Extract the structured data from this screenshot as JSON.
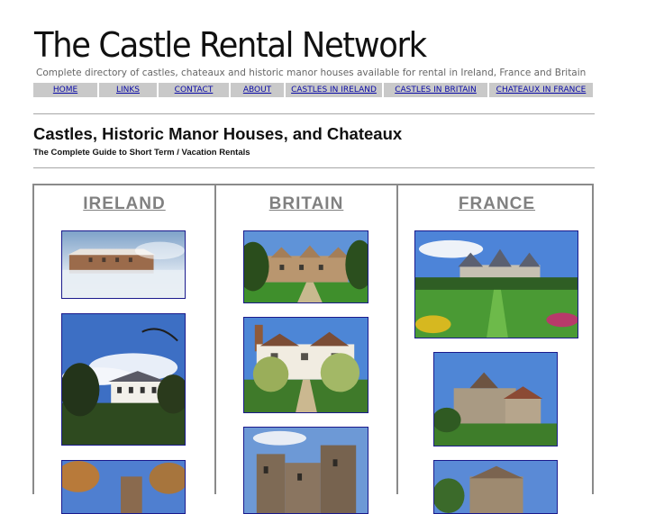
{
  "site": {
    "title": "The Castle Rental Network",
    "subtitle": "Complete directory of castles, chateaux and historic manor houses available for rental in Ireland, France and Britain"
  },
  "nav": {
    "items": [
      {
        "label": "HOME"
      },
      {
        "label": "LINKS"
      },
      {
        "label": "CONTACT"
      },
      {
        "label": "ABOUT"
      },
      {
        "label": "CASTLES IN IRELAND"
      },
      {
        "label": "CASTLES IN BRITAIN"
      },
      {
        "label": "CHATEAUX IN FRANCE"
      }
    ]
  },
  "main": {
    "heading": "Castles, Historic Manor Houses, and Chateaux",
    "subheading": "The Complete Guide to Short Term / Vacation Rentals"
  },
  "regions": [
    {
      "name": "IRELAND",
      "photos": [
        "misty-manor-house-photo",
        "white-country-house-photo",
        "tower-house-photo"
      ]
    },
    {
      "name": "BRITAIN",
      "photos": [
        "gabled-manor-photo",
        "manor-with-garden-path-photo",
        "stone-castle-photo"
      ]
    },
    {
      "name": "FRANCE",
      "photos": [
        "chateau-with-gardens-photo",
        "hilltop-chateau-photo",
        "stone-chateau-photo"
      ]
    }
  ],
  "colors": {
    "link": "#0a0aa6",
    "nav_background": "#c9c9c9",
    "region_heading": "#808080",
    "photo_border": "#1a1a8c"
  }
}
